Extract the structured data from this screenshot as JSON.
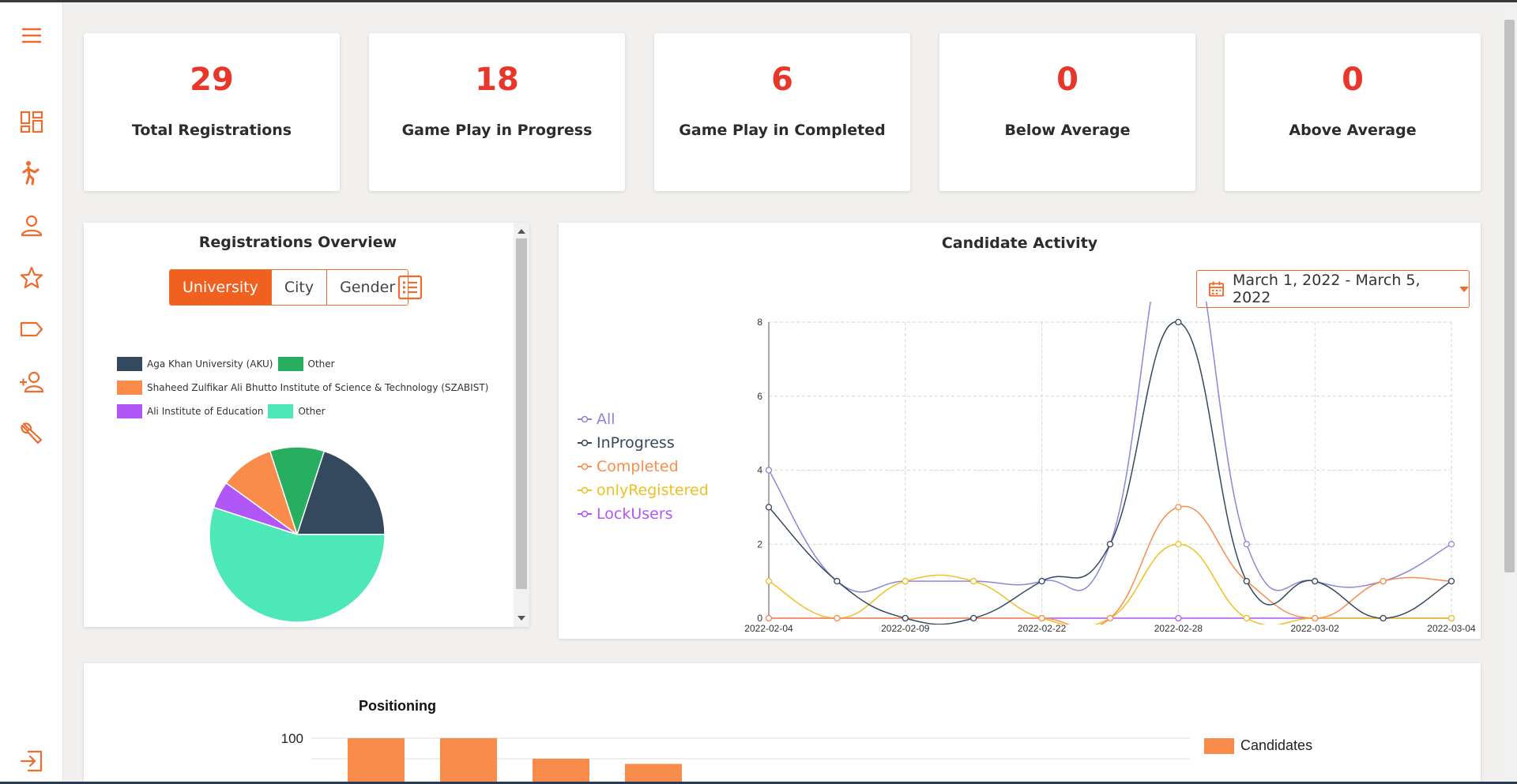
{
  "sidebar": {
    "items": [
      {
        "name": "menu-icon"
      },
      {
        "name": "dashboard-icon"
      },
      {
        "name": "player-icon"
      },
      {
        "name": "user-icon"
      },
      {
        "name": "star-icon"
      },
      {
        "name": "tag-icon"
      },
      {
        "name": "add-user-icon"
      },
      {
        "name": "wrench-icon"
      },
      {
        "name": "logout-icon"
      }
    ],
    "accent": "#ef6b2e"
  },
  "stats": [
    {
      "value": "29",
      "label": "Total Registrations"
    },
    {
      "value": "18",
      "label": "Game Play in Progress"
    },
    {
      "value": "6",
      "label": "Game Play in Completed"
    },
    {
      "value": "0",
      "label": "Below Average"
    },
    {
      "value": "0",
      "label": "Above Average"
    }
  ],
  "registrations": {
    "title": "Registrations Overview",
    "tabs": [
      "University",
      "City",
      "Gender"
    ],
    "active_tab": "University",
    "legend": [
      {
        "label": "Aga Khan University (AKU)",
        "color": "#34495e"
      },
      {
        "label": "Other",
        "color": "#27ae60"
      },
      {
        "label": "Shaheed Zulfikar Ali Bhutto Institute of Science & Technology (SZABIST)",
        "color": "#fa8c4b"
      },
      {
        "label": "Ali Institute of Education",
        "color": "#b257f7"
      },
      {
        "label": "Other",
        "color": "#4ce8b8"
      }
    ]
  },
  "activity": {
    "title": "Candidate Activity",
    "date_range": "March 1, 2022 - March 5, 2022",
    "series_legend": [
      {
        "name": "All",
        "color": "#8b87d8"
      },
      {
        "name": "InProgress",
        "color": "#34495e"
      },
      {
        "name": "Completed",
        "color": "#fa8c4b"
      },
      {
        "name": "onlyRegistered",
        "color": "#f0c020"
      },
      {
        "name": "LockUsers",
        "color": "#b257f7"
      }
    ]
  },
  "positioning": {
    "title": "Positioning",
    "legend_label": "Candidates",
    "legend_color": "#fa8c4b",
    "y_tick_top": "100",
    "bar_values": [
      100,
      100,
      80,
      75
    ]
  },
  "chart_data": [
    {
      "type": "pie",
      "title": "",
      "categories": [
        "Aga Khan University (AKU)",
        "Other",
        "Shaheed Zulfikar Ali Bhutto Institute of Science & Technology (SZABIST)",
        "Ali Institute of Education",
        "Other"
      ],
      "values": [
        4,
        2,
        2,
        1,
        11
      ],
      "colors": [
        "#34495e",
        "#27ae60",
        "#fa8c4b",
        "#b257f7",
        "#4ce8b8"
      ]
    },
    {
      "type": "line",
      "title": "Candidate Activity",
      "x": [
        "2022-02-04",
        "2022-02-05",
        "2022-02-09",
        "2022-02-10",
        "2022-02-22",
        "2022-02-23",
        "2022-02-28",
        "2022-03-01",
        "2022-03-02",
        "2022-03-03",
        "2022-03-04"
      ],
      "xticks": [
        "2022-02-04",
        "2022-02-09",
        "2022-02-22",
        "2022-02-28",
        "2022-03-02",
        "2022-03-04"
      ],
      "ylim": [
        0,
        8
      ],
      "yticks": [
        0,
        2,
        4,
        6,
        8
      ],
      "grid": true,
      "series": [
        {
          "name": "All",
          "values": [
            4,
            1,
            1,
            1,
            1,
            2,
            11,
            2,
            1,
            1,
            2
          ]
        },
        {
          "name": "InProgress",
          "values": [
            3,
            1,
            0,
            0,
            1,
            2,
            8,
            1,
            1,
            0,
            1
          ]
        },
        {
          "name": "Completed",
          "values": [
            0,
            0,
            0,
            0,
            0,
            0,
            3,
            1,
            0,
            1,
            1
          ]
        },
        {
          "name": "onlyRegistered",
          "values": [
            1,
            0,
            1,
            1,
            0,
            0,
            2,
            0,
            0,
            0,
            0
          ]
        },
        {
          "name": "LockUsers",
          "values": [
            0,
            0,
            0,
            0,
            0,
            0,
            0,
            0,
            0,
            0,
            0
          ]
        }
      ]
    },
    {
      "type": "bar",
      "title": "Positioning",
      "categories": [
        "",
        "",
        "",
        ""
      ],
      "series": [
        {
          "name": "Candidates",
          "values": [
            100,
            100,
            80,
            75
          ]
        }
      ]
    }
  ]
}
